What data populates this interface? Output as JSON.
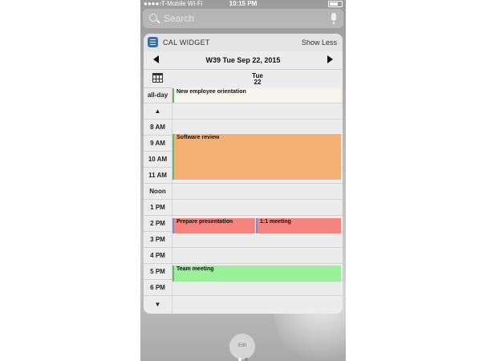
{
  "status": {
    "carrier": "T-Mobile Wi-Fi",
    "time": "10:15 PM"
  },
  "search": {
    "placeholder": "Search"
  },
  "widget": {
    "title": "CAL WIDGET",
    "toggle": "Show Less"
  },
  "nav": {
    "title": "W39 Tue Sep 22, 2015"
  },
  "day": {
    "name": "Tue",
    "number": "22"
  },
  "rows": [
    "all-day",
    "▲",
    "8 AM",
    "9 AM",
    "10 AM",
    "11 AM",
    "Noon",
    "1 PM",
    "2 PM",
    "3 PM",
    "4 PM",
    "5 PM",
    "6 PM",
    "▼"
  ],
  "events": [
    {
      "title": "New employee orientation",
      "color": "#f7f6ec",
      "bar": "#6db56d"
    },
    {
      "title": "Software review",
      "color": "#f5b173",
      "bar": "#6db56d"
    },
    {
      "title": "Prepare presentation",
      "color": "#f5847e",
      "bar": "#8888cc"
    },
    {
      "title": "1:1 meeting",
      "color": "#f5847e",
      "bar": "#8888cc"
    },
    {
      "title": "Team meeting",
      "color": "#99f099",
      "bar": "#6db56d"
    }
  ],
  "dots": [
    "#6db56d",
    "#4a7fd0",
    "#c06ac0",
    "#f08a4a"
  ],
  "footer": {
    "edit": "Edit"
  }
}
